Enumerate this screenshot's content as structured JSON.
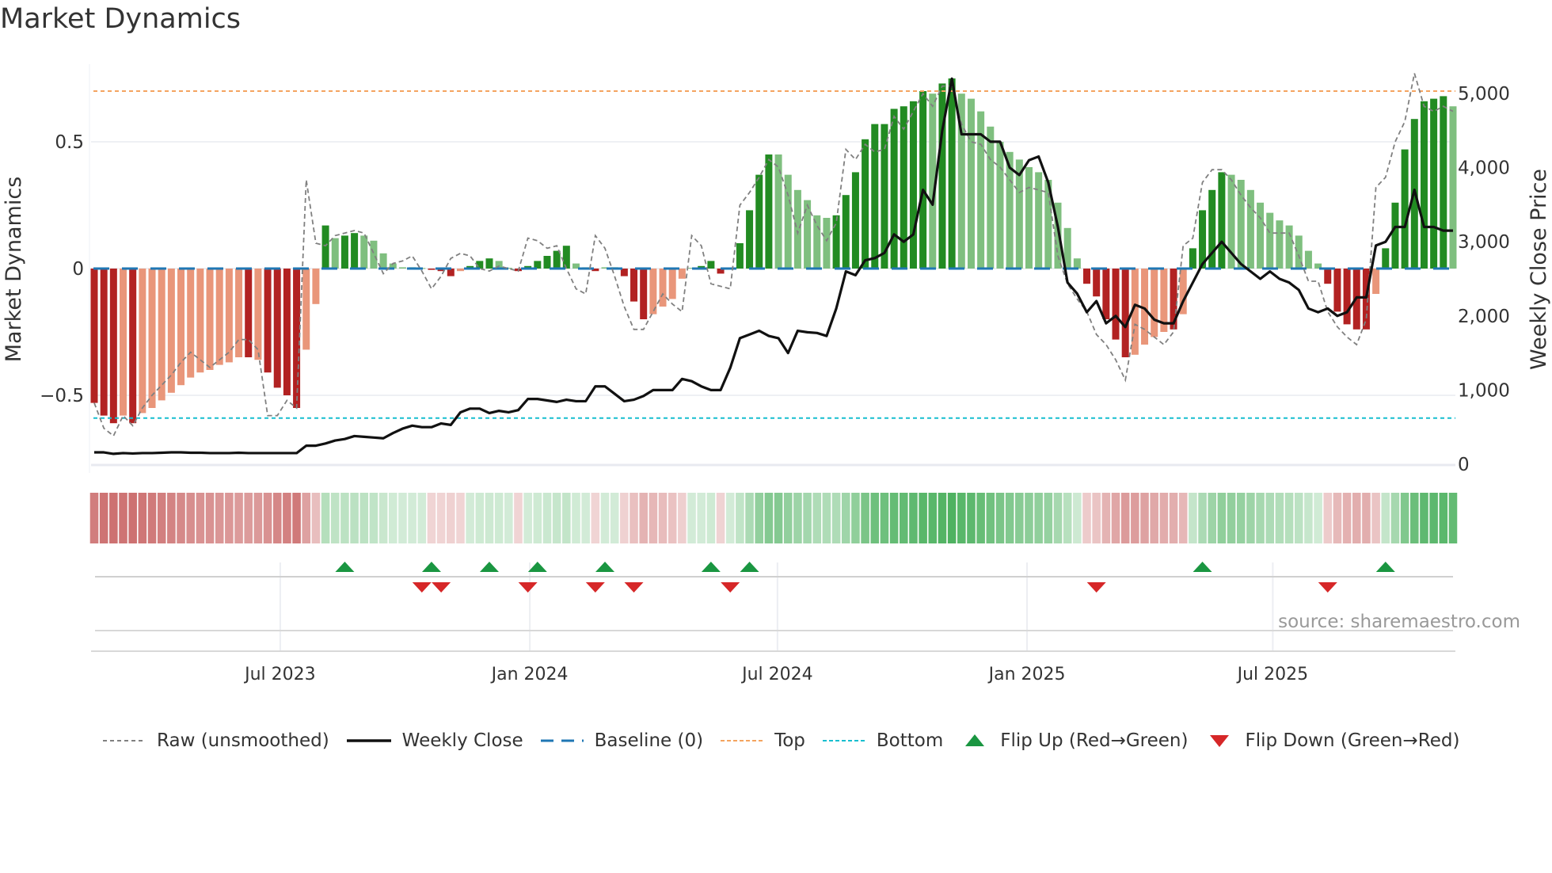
{
  "title": "Market Dynamics",
  "source": "source: sharemaestro.com",
  "colors": {
    "strong_up": "#228b22",
    "weak_up": "#7fbf7f",
    "strong_down": "#b22222",
    "weak_down": "#e9967a",
    "top": "#f4a460",
    "bottom": "#17becf",
    "baseline": "#1f77b4",
    "raw": "#808080",
    "close": "#111111",
    "flip_up": "#1a9641",
    "flip_down": "#d62728"
  },
  "legend": [
    {
      "key": "raw",
      "label": "Raw (unsmoothed)"
    },
    {
      "key": "close",
      "label": "Weekly Close"
    },
    {
      "key": "baseline",
      "label": "Baseline (0)"
    },
    {
      "key": "top",
      "label": "Top"
    },
    {
      "key": "bottom",
      "label": "Bottom"
    },
    {
      "key": "flip_up",
      "label": "Flip Up (Red→Green)"
    },
    {
      "key": "flip_down",
      "label": "Flip Down (Green→Red)"
    }
  ],
  "chart_data": {
    "type": "bar",
    "title": "Market Dynamics",
    "ylabel": "Market Dynamics",
    "y2label": "Weekly Close Price",
    "ylim": [
      -0.77,
      0.81
    ],
    "y2lim": [
      0,
      5300
    ],
    "yticks": [
      {
        "v": 0.5,
        "label": "0.5"
      },
      {
        "v": 0,
        "label": "0"
      },
      {
        "v": -0.5,
        "label": "−0.5"
      }
    ],
    "y2ticks": [
      {
        "v": 5000,
        "label": "5,000"
      },
      {
        "v": 4000,
        "label": "4,000"
      },
      {
        "v": 3000,
        "label": "3,000"
      },
      {
        "v": 2000,
        "label": "2,000"
      },
      {
        "v": 1000,
        "label": "1,000"
      },
      {
        "v": 0,
        "label": "0"
      }
    ],
    "xticks": [
      {
        "week": 20.3,
        "label": "Jul 2023"
      },
      {
        "week": 46.2,
        "label": "Jan 2024"
      },
      {
        "week": 71.9,
        "label": "Jul 2024"
      },
      {
        "week": 97.8,
        "label": "Jan 2025"
      },
      {
        "week": 123.3,
        "label": "Jul 2025"
      }
    ],
    "top_level": 0.7,
    "bottom_level": -0.59,
    "baseline": 0,
    "smoothed": [
      -0.53,
      -0.58,
      -0.61,
      -0.58,
      -0.61,
      -0.57,
      -0.55,
      -0.52,
      -0.49,
      -0.46,
      -0.43,
      -0.41,
      -0.4,
      -0.38,
      -0.37,
      -0.35,
      -0.35,
      -0.36,
      -0.41,
      -0.47,
      -0.5,
      -0.55,
      -0.32,
      -0.14,
      0.17,
      0.12,
      0.13,
      0.14,
      0.13,
      0.11,
      0.06,
      0.02,
      0.005,
      0.005,
      0.002,
      -0.005,
      -0.01,
      -0.03,
      -0.01,
      0.01,
      0.03,
      0.04,
      0.03,
      0.003,
      -0.01,
      0.01,
      0.03,
      0.05,
      0.07,
      0.09,
      0.02,
      0.005,
      -0.01,
      0.005,
      0.005,
      -0.03,
      -0.13,
      -0.2,
      -0.18,
      -0.15,
      -0.12,
      -0.04,
      0.003,
      0.01,
      0.03,
      -0.02,
      0.0,
      0.1,
      0.23,
      0.37,
      0.45,
      0.45,
      0.37,
      0.31,
      0.27,
      0.21,
      0.2,
      0.21,
      0.29,
      0.38,
      0.51,
      0.57,
      0.57,
      0.63,
      0.64,
      0.66,
      0.7,
      0.69,
      0.73,
      0.75,
      0.69,
      0.67,
      0.62,
      0.56,
      0.5,
      0.46,
      0.43,
      0.4,
      0.38,
      0.35,
      0.26,
      0.16,
      0.04,
      -0.06,
      -0.11,
      -0.2,
      -0.28,
      -0.35,
      -0.34,
      -0.3,
      -0.27,
      -0.25,
      -0.24,
      -0.18,
      0.08,
      0.23,
      0.31,
      0.38,
      0.37,
      0.35,
      0.31,
      0.26,
      0.22,
      0.19,
      0.17,
      0.13,
      0.07,
      0.02,
      -0.06,
      -0.17,
      -0.22,
      -0.24,
      -0.24,
      -0.1,
      0.08,
      0.26,
      0.47,
      0.59,
      0.66,
      0.67,
      0.68,
      0.64
    ],
    "strong": [
      1,
      1,
      1,
      0,
      1,
      0,
      0,
      0,
      0,
      0,
      0,
      0,
      0,
      0,
      0,
      0,
      1,
      0,
      1,
      1,
      1,
      1,
      0,
      0,
      1,
      0,
      1,
      1,
      0,
      0,
      0,
      0,
      0,
      1,
      0,
      1,
      1,
      1,
      0,
      1,
      1,
      1,
      0,
      0,
      1,
      1,
      1,
      1,
      1,
      1,
      0,
      0,
      1,
      0,
      1,
      1,
      1,
      1,
      0,
      0,
      0,
      0,
      0,
      1,
      1,
      1,
      0,
      1,
      1,
      1,
      1,
      0,
      0,
      0,
      0,
      0,
      0,
      1,
      1,
      1,
      1,
      1,
      1,
      1,
      1,
      1,
      1,
      0,
      1,
      1,
      0,
      0,
      0,
      0,
      0,
      0,
      0,
      0,
      0,
      0,
      0,
      0,
      0,
      1,
      1,
      1,
      1,
      1,
      0,
      0,
      0,
      0,
      1,
      0,
      1,
      1,
      1,
      1,
      0,
      0,
      0,
      0,
      0,
      0,
      0,
      0,
      0,
      0,
      1,
      1,
      1,
      1,
      1,
      0,
      1,
      1,
      1,
      1,
      1,
      1,
      1,
      0
    ],
    "raw": [
      -0.53,
      -0.63,
      -0.66,
      -0.58,
      -0.62,
      -0.55,
      -0.5,
      -0.46,
      -0.42,
      -0.37,
      -0.33,
      -0.36,
      -0.39,
      -0.36,
      -0.33,
      -0.28,
      -0.28,
      -0.32,
      -0.58,
      -0.58,
      -0.52,
      -0.55,
      0.35,
      0.1,
      0.09,
      0.13,
      0.14,
      0.15,
      0.14,
      0.06,
      -0.02,
      0.02,
      0.03,
      0.05,
      -0.01,
      -0.08,
      -0.03,
      0.04,
      0.06,
      0.05,
      0.0,
      -0.01,
      0.01,
      0.0,
      -0.01,
      0.12,
      0.11,
      0.08,
      0.09,
      0.0,
      -0.08,
      -0.1,
      0.13,
      0.08,
      -0.03,
      -0.15,
      -0.24,
      -0.24,
      -0.17,
      -0.1,
      -0.14,
      -0.17,
      0.13,
      0.09,
      -0.06,
      -0.07,
      -0.08,
      0.25,
      0.3,
      0.36,
      0.43,
      0.4,
      0.29,
      0.14,
      0.25,
      0.17,
      0.11,
      0.18,
      0.47,
      0.43,
      0.49,
      0.46,
      0.47,
      0.6,
      0.55,
      0.62,
      0.69,
      0.64,
      0.72,
      0.72,
      0.57,
      0.5,
      0.49,
      0.43,
      0.4,
      0.35,
      0.3,
      0.32,
      0.31,
      0.3,
      0.05,
      -0.06,
      -0.12,
      -0.17,
      -0.26,
      -0.3,
      -0.36,
      -0.44,
      -0.22,
      -0.24,
      -0.27,
      -0.3,
      -0.25,
      0.09,
      0.12,
      0.34,
      0.39,
      0.39,
      0.35,
      0.29,
      0.24,
      0.2,
      0.14,
      0.14,
      0.14,
      0.05,
      -0.05,
      -0.05,
      -0.17,
      -0.23,
      -0.27,
      -0.3,
      -0.2,
      0.32,
      0.36,
      0.5,
      0.58,
      0.77,
      0.64,
      0.62,
      0.64,
      0.62
    ],
    "close": [
      160,
      160,
      140,
      150,
      145,
      150,
      150,
      155,
      160,
      160,
      155,
      155,
      150,
      150,
      150,
      155,
      150,
      150,
      150,
      150,
      150,
      150,
      250,
      250,
      280,
      320,
      340,
      380,
      370,
      360,
      350,
      420,
      480,
      520,
      500,
      500,
      550,
      530,
      700,
      750,
      750,
      690,
      720,
      700,
      730,
      880,
      880,
      860,
      840,
      870,
      850,
      850,
      1050,
      1050,
      950,
      850,
      870,
      920,
      1000,
      1000,
      1000,
      1150,
      1120,
      1050,
      1000,
      1000,
      1300,
      1700,
      1750,
      1800,
      1730,
      1700,
      1500,
      1800,
      1780,
      1770,
      1730,
      2100,
      2600,
      2550,
      2750,
      2780,
      2850,
      3100,
      3000,
      3100,
      3700,
      3500,
      4500,
      5200,
      4450,
      4450,
      4450,
      4350,
      4350,
      4000,
      3900,
      4100,
      4150,
      3800,
      3200,
      2450,
      2300,
      2050,
      2200,
      1900,
      2000,
      1850,
      2150,
      2100,
      1950,
      1900,
      1900,
      2200,
      2450,
      2700,
      2850,
      3000,
      2850,
      2700,
      2600,
      2500,
      2600,
      2500,
      2450,
      2350,
      2100,
      2050,
      2100,
      2000,
      2050,
      2250,
      2250,
      2950,
      3000,
      3200,
      3200,
      3700,
      3200,
      3200,
      3150,
      3150
    ],
    "flip_up_weeks": [
      27,
      36,
      42,
      47,
      54,
      65,
      69,
      116,
      135
    ],
    "flip_down_weeks": [
      35,
      37,
      46,
      53,
      57,
      67,
      105,
      129
    ]
  }
}
